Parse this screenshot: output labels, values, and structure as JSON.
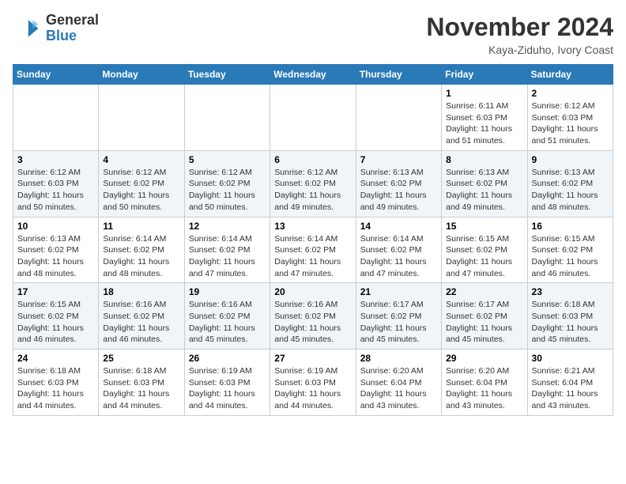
{
  "header": {
    "logo_general": "General",
    "logo_blue": "Blue",
    "month_title": "November 2024",
    "location": "Kaya-Ziduho, Ivory Coast"
  },
  "days_of_week": [
    "Sunday",
    "Monday",
    "Tuesday",
    "Wednesday",
    "Thursday",
    "Friday",
    "Saturday"
  ],
  "weeks": [
    [
      {
        "day": "",
        "info": ""
      },
      {
        "day": "",
        "info": ""
      },
      {
        "day": "",
        "info": ""
      },
      {
        "day": "",
        "info": ""
      },
      {
        "day": "",
        "info": ""
      },
      {
        "day": "1",
        "info": "Sunrise: 6:11 AM\nSunset: 6:03 PM\nDaylight: 11 hours and 51 minutes."
      },
      {
        "day": "2",
        "info": "Sunrise: 6:12 AM\nSunset: 6:03 PM\nDaylight: 11 hours and 51 minutes."
      }
    ],
    [
      {
        "day": "3",
        "info": "Sunrise: 6:12 AM\nSunset: 6:03 PM\nDaylight: 11 hours and 50 minutes."
      },
      {
        "day": "4",
        "info": "Sunrise: 6:12 AM\nSunset: 6:02 PM\nDaylight: 11 hours and 50 minutes."
      },
      {
        "day": "5",
        "info": "Sunrise: 6:12 AM\nSunset: 6:02 PM\nDaylight: 11 hours and 50 minutes."
      },
      {
        "day": "6",
        "info": "Sunrise: 6:12 AM\nSunset: 6:02 PM\nDaylight: 11 hours and 49 minutes."
      },
      {
        "day": "7",
        "info": "Sunrise: 6:13 AM\nSunset: 6:02 PM\nDaylight: 11 hours and 49 minutes."
      },
      {
        "day": "8",
        "info": "Sunrise: 6:13 AM\nSunset: 6:02 PM\nDaylight: 11 hours and 49 minutes."
      },
      {
        "day": "9",
        "info": "Sunrise: 6:13 AM\nSunset: 6:02 PM\nDaylight: 11 hours and 48 minutes."
      }
    ],
    [
      {
        "day": "10",
        "info": "Sunrise: 6:13 AM\nSunset: 6:02 PM\nDaylight: 11 hours and 48 minutes."
      },
      {
        "day": "11",
        "info": "Sunrise: 6:14 AM\nSunset: 6:02 PM\nDaylight: 11 hours and 48 minutes."
      },
      {
        "day": "12",
        "info": "Sunrise: 6:14 AM\nSunset: 6:02 PM\nDaylight: 11 hours and 47 minutes."
      },
      {
        "day": "13",
        "info": "Sunrise: 6:14 AM\nSunset: 6:02 PM\nDaylight: 11 hours and 47 minutes."
      },
      {
        "day": "14",
        "info": "Sunrise: 6:14 AM\nSunset: 6:02 PM\nDaylight: 11 hours and 47 minutes."
      },
      {
        "day": "15",
        "info": "Sunrise: 6:15 AM\nSunset: 6:02 PM\nDaylight: 11 hours and 47 minutes."
      },
      {
        "day": "16",
        "info": "Sunrise: 6:15 AM\nSunset: 6:02 PM\nDaylight: 11 hours and 46 minutes."
      }
    ],
    [
      {
        "day": "17",
        "info": "Sunrise: 6:15 AM\nSunset: 6:02 PM\nDaylight: 11 hours and 46 minutes."
      },
      {
        "day": "18",
        "info": "Sunrise: 6:16 AM\nSunset: 6:02 PM\nDaylight: 11 hours and 46 minutes."
      },
      {
        "day": "19",
        "info": "Sunrise: 6:16 AM\nSunset: 6:02 PM\nDaylight: 11 hours and 45 minutes."
      },
      {
        "day": "20",
        "info": "Sunrise: 6:16 AM\nSunset: 6:02 PM\nDaylight: 11 hours and 45 minutes."
      },
      {
        "day": "21",
        "info": "Sunrise: 6:17 AM\nSunset: 6:02 PM\nDaylight: 11 hours and 45 minutes."
      },
      {
        "day": "22",
        "info": "Sunrise: 6:17 AM\nSunset: 6:02 PM\nDaylight: 11 hours and 45 minutes."
      },
      {
        "day": "23",
        "info": "Sunrise: 6:18 AM\nSunset: 6:03 PM\nDaylight: 11 hours and 45 minutes."
      }
    ],
    [
      {
        "day": "24",
        "info": "Sunrise: 6:18 AM\nSunset: 6:03 PM\nDaylight: 11 hours and 44 minutes."
      },
      {
        "day": "25",
        "info": "Sunrise: 6:18 AM\nSunset: 6:03 PM\nDaylight: 11 hours and 44 minutes."
      },
      {
        "day": "26",
        "info": "Sunrise: 6:19 AM\nSunset: 6:03 PM\nDaylight: 11 hours and 44 minutes."
      },
      {
        "day": "27",
        "info": "Sunrise: 6:19 AM\nSunset: 6:03 PM\nDaylight: 11 hours and 44 minutes."
      },
      {
        "day": "28",
        "info": "Sunrise: 6:20 AM\nSunset: 6:04 PM\nDaylight: 11 hours and 43 minutes."
      },
      {
        "day": "29",
        "info": "Sunrise: 6:20 AM\nSunset: 6:04 PM\nDaylight: 11 hours and 43 minutes."
      },
      {
        "day": "30",
        "info": "Sunrise: 6:21 AM\nSunset: 6:04 PM\nDaylight: 11 hours and 43 minutes."
      }
    ]
  ]
}
